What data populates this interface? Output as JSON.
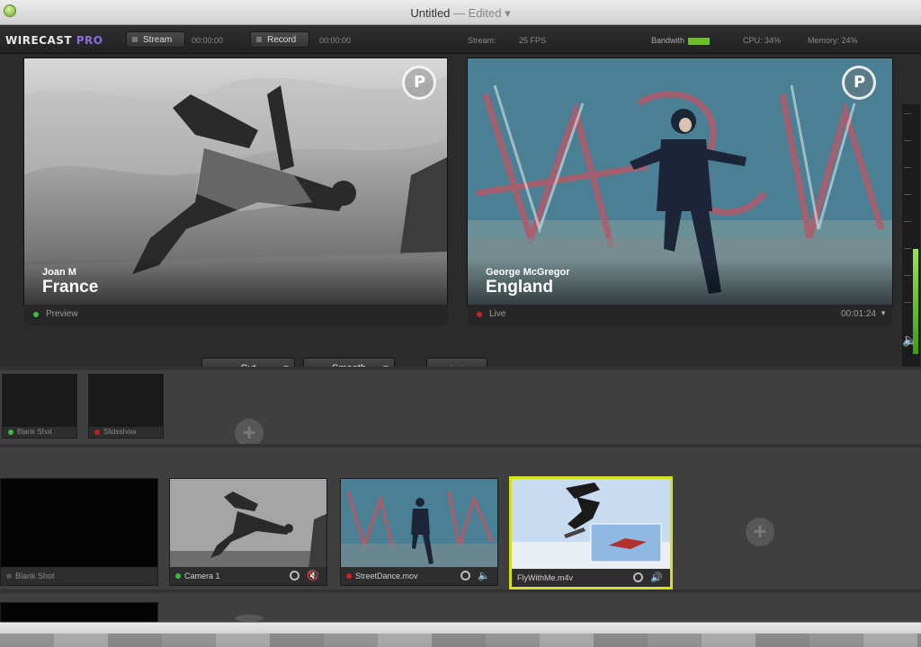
{
  "window": {
    "title": "Untitled",
    "edited": "— Edited ▾"
  },
  "toolbar": {
    "brand": "WIRECAST",
    "brand_suffix": "PRO",
    "stream_label": "Stream",
    "stream_time": "00:00:00",
    "record_label": "Record",
    "record_time": "00:00:00",
    "stream_stat": "Stream:",
    "fps": "25 FPS",
    "bandwidth_label": "Bandwith",
    "cpu": "CPU: 34%",
    "memory": "Memory: 24%"
  },
  "preview": {
    "name": "Joan M",
    "place": "France",
    "label": "Preview",
    "status_color": "#3fb83f"
  },
  "live": {
    "name": "George McGregor",
    "place": "England",
    "label": "Live",
    "time": "00:01:24",
    "status_color": "#d02020"
  },
  "transitions": {
    "cut": "Cut",
    "smooth": "Smooth",
    "go": "⟷"
  },
  "audio_meter": {
    "level": 0.42
  },
  "layers": [
    {
      "shots": [
        {
          "name": "Blank Shot",
          "dot": "#3fb83f"
        },
        {
          "name": "Slideshow",
          "dot": "#c02020"
        }
      ]
    },
    {
      "shots": [
        {
          "name": "Blank Shot",
          "dot": "#555555"
        },
        {
          "name": "Camera 1",
          "dot": "#3fb83f"
        },
        {
          "name": "StreetDance.mov",
          "dot": "#d02020"
        },
        {
          "name": "FlyWithMe.m4v",
          "dot": "none"
        }
      ]
    }
  ],
  "colors": {
    "accent_purple": "#8c6cd8",
    "selected_border": "#d6e021",
    "bandwidth_green": "#6cbf2a"
  }
}
